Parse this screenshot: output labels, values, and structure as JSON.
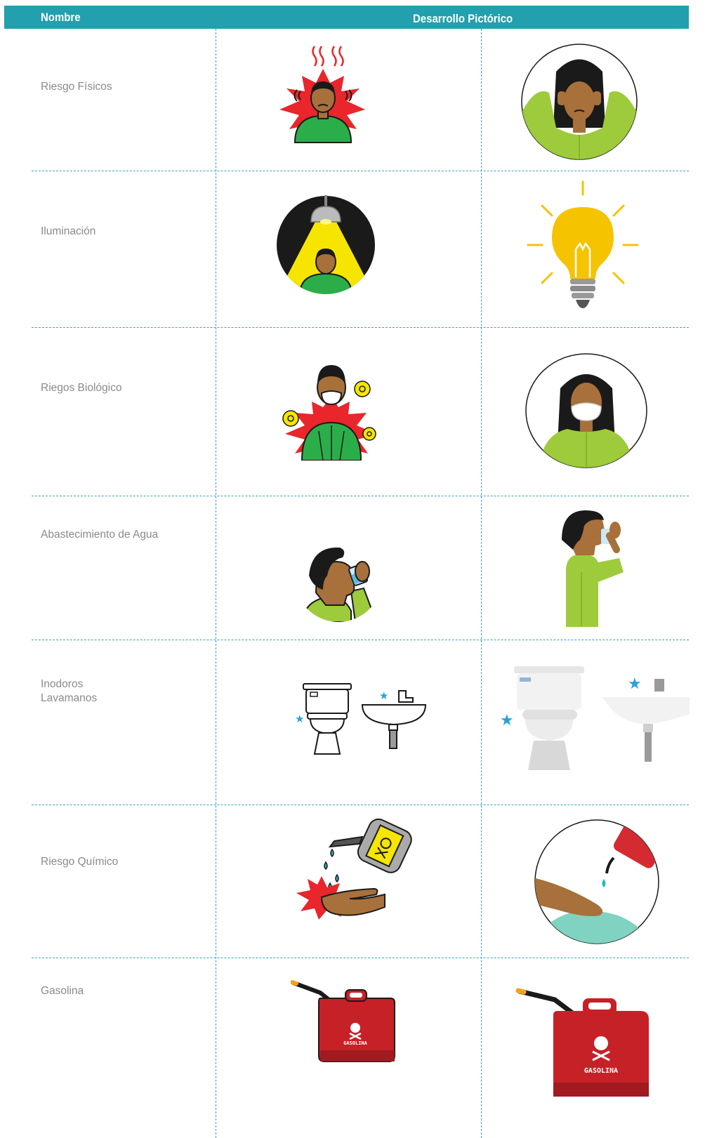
{
  "header": {
    "col_name": "Nombre",
    "col_development": "Desarrollo Pictórico",
    "bg_color": "#22a0ad"
  },
  "rows": [
    {
      "label": "Riesgo Físicos"
    },
    {
      "label": "Iluminación"
    },
    {
      "label": "Riegos Biológico"
    },
    {
      "label": "Abastecimiento de Agua"
    },
    {
      "label_line1": "Inodoros",
      "label_line2": "Lavamanos"
    },
    {
      "label": "Riesgo Químico"
    },
    {
      "label": "Gasolina",
      "can_text": "GASOLINA"
    }
  ],
  "colors": {
    "grid_line": "#39a3c4",
    "label_text": "#8a8a8a",
    "alert_red": "#e8262b",
    "shirt_green": "#2bae4a",
    "shirt_lime": "#9dcb3b",
    "bulb_yellow": "#f6c300",
    "skin": "#a8703a",
    "can_red": "#c62127"
  }
}
